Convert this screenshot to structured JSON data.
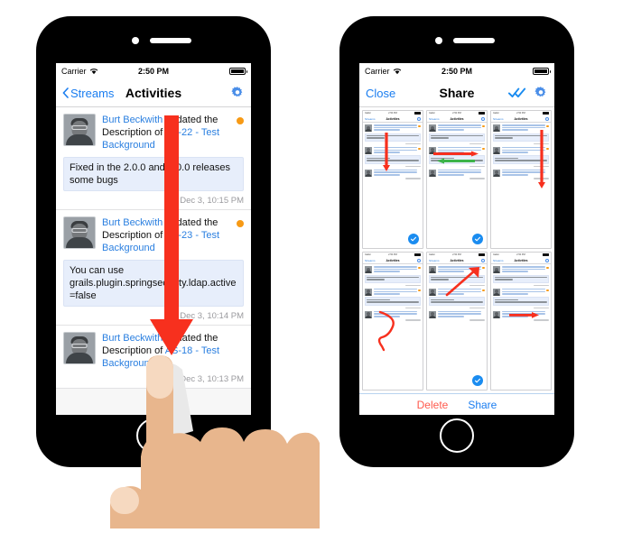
{
  "meta": {
    "accent_blue": "#1a7df0",
    "link_blue": "#2a7fe0",
    "orange_dot": "#f79a15",
    "delete_red": "#ff5a4d",
    "bubble_bg": "#e7eefb",
    "annotation_red": "#f7301e",
    "annotation_green": "#3cb44a",
    "frame_black": "#000000",
    "skin": "#e8b68d"
  },
  "left_phone": {
    "name": "activities-phone",
    "status_bar": {
      "carrier": "Carrier",
      "wifi_icon": "wifi-icon",
      "time": "2:50 PM",
      "battery_icon": "battery-icon"
    },
    "nav": {
      "back_label": "Streams",
      "back_icon": "chevron-left-icon",
      "title": "Activities",
      "settings_icon": "gear-icon"
    },
    "activities": [
      {
        "avatar": "avatar-burt-beckwith",
        "user": "Burt Beckwith",
        "action": " updated the Description of ",
        "issue": "AS-22 - Test Background",
        "unread_dot": true,
        "comment": "Fixed in the 2.0.0 and 3.0.0 releases some bugs",
        "timestamp": "Dec 3, 10:15 PM"
      },
      {
        "avatar": "avatar-burt-beckwith",
        "user": "Burt Beckwith",
        "action": " updated the Description of ",
        "issue": "AS-23 - Test Background",
        "unread_dot": true,
        "comment": "You can use grails.plugin.springsecurity.ldap.active=false",
        "timestamp": "Dec 3, 10:14 PM"
      },
      {
        "avatar": "avatar-burt-beckwith",
        "user": "Burt Beckwith",
        "action": " updated the Description of ",
        "issue": "AS-18 - Test Background",
        "unread_dot": false,
        "comment": null,
        "timestamp": "Dec 3, 10:13 PM"
      }
    ],
    "annotation": {
      "type": "downward-arrow",
      "label": "swipe-down-arrow",
      "color": "#f7301e"
    },
    "gesture": {
      "label": "pointing-hand",
      "skin": "#e8b68d"
    }
  },
  "right_phone": {
    "name": "share-phone",
    "status_bar": {
      "carrier": "Carrier",
      "wifi_icon": "wifi-icon",
      "time": "2:50 PM",
      "battery_icon": "battery-icon"
    },
    "nav": {
      "close_label": "Close",
      "title": "Share",
      "select_all_icon": "double-check-icon",
      "settings_icon": "gear-icon"
    },
    "thumbnails": [
      {
        "id": "thumb-1",
        "nav_back": "Streams",
        "nav_title": "Activities",
        "selected": true,
        "annotation": "vertical-red-arrow-down"
      },
      {
        "id": "thumb-2",
        "nav_back": "Streams",
        "nav_title": "Activities",
        "selected": true,
        "annotation": "red-and-green-horizontal-arrows"
      },
      {
        "id": "thumb-3",
        "nav_back": "Streams",
        "nav_title": "Activities",
        "selected": false,
        "annotation": "tall-vertical-red-arrow"
      },
      {
        "id": "thumb-4",
        "nav_back": "Streams",
        "nav_title": "Activities",
        "selected": false,
        "annotation": "red-squiggle-curve"
      },
      {
        "id": "thumb-5",
        "nav_back": "Streams",
        "nav_title": "Activities",
        "selected": true,
        "annotation": "diagonal-red-arrow-to-gear"
      },
      {
        "id": "thumb-6",
        "nav_back": "Streams",
        "nav_title": "Activities",
        "selected": false,
        "annotation": "short-horizontal-red-arrow"
      }
    ],
    "toolbar": {
      "delete_label": "Delete",
      "share_label": "Share"
    }
  }
}
